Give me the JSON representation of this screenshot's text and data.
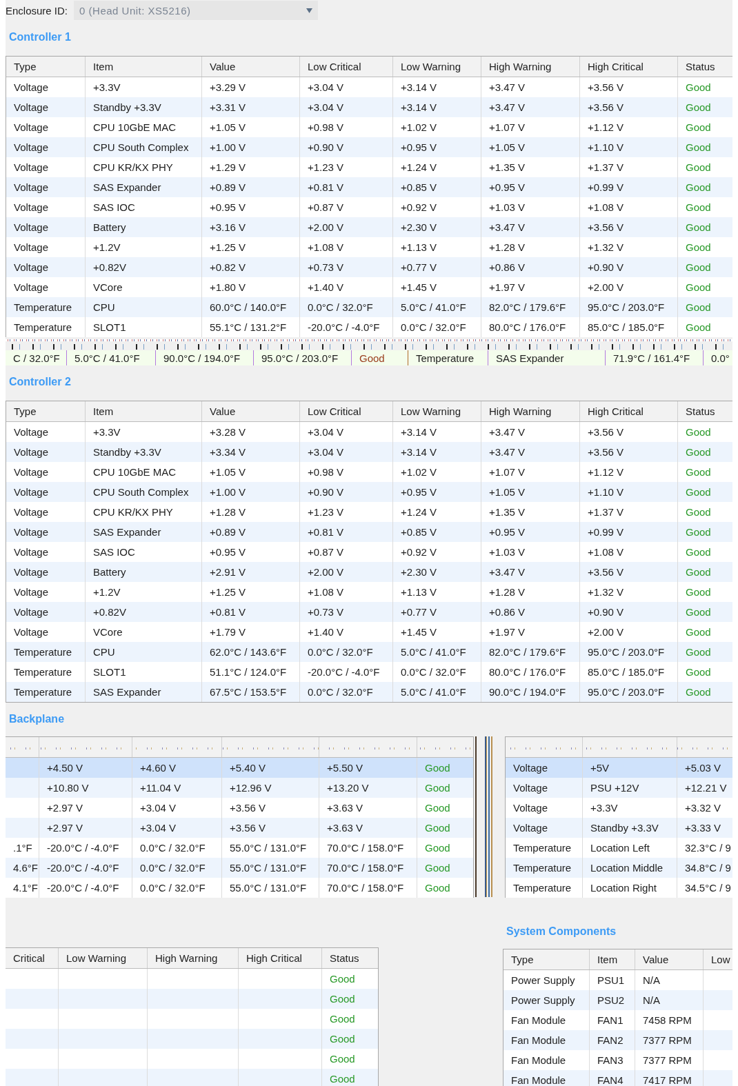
{
  "enclosure": {
    "label": "Enclosure ID:",
    "value": "0 (Head Unit: XS5216)"
  },
  "controller_1": {
    "title": "Controller 1",
    "columns": [
      "Type",
      "Item",
      "Value",
      "Low Critical",
      "Low Warning",
      "High Warning",
      "High Critical",
      "Status"
    ],
    "rows": [
      [
        "Voltage",
        "+3.3V",
        "+3.29 V",
        "+3.04 V",
        "+3.14 V",
        "+3.47 V",
        "+3.56 V",
        "Good"
      ],
      [
        "Voltage",
        "Standby +3.3V",
        "+3.31 V",
        "+3.04 V",
        "+3.14 V",
        "+3.47 V",
        "+3.56 V",
        "Good"
      ],
      [
        "Voltage",
        "CPU 10GbE MAC",
        "+1.05 V",
        "+0.98 V",
        "+1.02 V",
        "+1.07 V",
        "+1.12 V",
        "Good"
      ],
      [
        "Voltage",
        "CPU South Complex",
        "+1.00 V",
        "+0.90 V",
        "+0.95 V",
        "+1.05 V",
        "+1.10 V",
        "Good"
      ],
      [
        "Voltage",
        "CPU KR/KX PHY",
        "+1.29 V",
        "+1.23 V",
        "+1.24 V",
        "+1.35 V",
        "+1.37 V",
        "Good"
      ],
      [
        "Voltage",
        "SAS Expander",
        "+0.89 V",
        "+0.81 V",
        "+0.85 V",
        "+0.95 V",
        "+0.99 V",
        "Good"
      ],
      [
        "Voltage",
        "SAS IOC",
        "+0.95 V",
        "+0.87 V",
        "+0.92 V",
        "+1.03 V",
        "+1.08 V",
        "Good"
      ],
      [
        "Voltage",
        "Battery",
        "+3.16 V",
        "+2.00 V",
        "+2.30 V",
        "+3.47 V",
        "+3.56 V",
        "Good"
      ],
      [
        "Voltage",
        "+1.2V",
        "+1.25 V",
        "+1.08 V",
        "+1.13 V",
        "+1.28 V",
        "+1.32 V",
        "Good"
      ],
      [
        "Voltage",
        "+0.82V",
        "+0.82 V",
        "+0.73 V",
        "+0.77 V",
        "+0.86 V",
        "+0.90 V",
        "Good"
      ],
      [
        "Voltage",
        "VCore",
        "+1.80 V",
        "+1.40 V",
        "+1.45 V",
        "+1.97 V",
        "+2.00 V",
        "Good"
      ],
      [
        "Temperature",
        "CPU",
        "60.0°C / 140.0°F",
        "0.0°C / 32.0°F",
        "5.0°C / 41.0°F",
        "82.0°C / 179.6°F",
        "95.0°C / 203.0°F",
        "Good"
      ],
      [
        "Temperature",
        "SLOT1",
        "55.1°C / 131.2°F",
        "-20.0°C / -4.0°F",
        "0.0°C / 32.0°F",
        "80.0°C / 176.0°F",
        "85.0°C / 185.0°F",
        "Good"
      ]
    ]
  },
  "glitch_strip": [
    {
      "text": "C / 32.0°F",
      "kind": "value"
    },
    {
      "text": "5.0°C / 41.0°F",
      "kind": "value"
    },
    {
      "text": "90.0°C / 194.0°F",
      "kind": "value"
    },
    {
      "text": "95.0°C / 203.0°F",
      "kind": "value"
    },
    {
      "text": "Good",
      "kind": "status"
    },
    {
      "text": "Temperature",
      "kind": "value"
    },
    {
      "text": "SAS Expander",
      "kind": "value"
    },
    {
      "text": "71.9°C / 161.4°F",
      "kind": "value"
    },
    {
      "text": "0.0°",
      "kind": "value"
    }
  ],
  "controller_2": {
    "title": "Controller 2",
    "columns": [
      "Type",
      "Item",
      "Value",
      "Low Critical",
      "Low Warning",
      "High Warning",
      "High Critical",
      "Status"
    ],
    "rows": [
      [
        "Voltage",
        "+3.3V",
        "+3.28 V",
        "+3.04 V",
        "+3.14 V",
        "+3.47 V",
        "+3.56 V",
        "Good"
      ],
      [
        "Voltage",
        "Standby +3.3V",
        "+3.34 V",
        "+3.04 V",
        "+3.14 V",
        "+3.47 V",
        "+3.56 V",
        "Good"
      ],
      [
        "Voltage",
        "CPU 10GbE MAC",
        "+1.05 V",
        "+0.98 V",
        "+1.02 V",
        "+1.07 V",
        "+1.12 V",
        "Good"
      ],
      [
        "Voltage",
        "CPU South Complex",
        "+1.00 V",
        "+0.90 V",
        "+0.95 V",
        "+1.05 V",
        "+1.10 V",
        "Good"
      ],
      [
        "Voltage",
        "CPU KR/KX PHY",
        "+1.28 V",
        "+1.23 V",
        "+1.24 V",
        "+1.35 V",
        "+1.37 V",
        "Good"
      ],
      [
        "Voltage",
        "SAS Expander",
        "+0.89 V",
        "+0.81 V",
        "+0.85 V",
        "+0.95 V",
        "+0.99 V",
        "Good"
      ],
      [
        "Voltage",
        "SAS IOC",
        "+0.95 V",
        "+0.87 V",
        "+0.92 V",
        "+1.03 V",
        "+1.08 V",
        "Good"
      ],
      [
        "Voltage",
        "Battery",
        "+2.91 V",
        "+2.00 V",
        "+2.30 V",
        "+3.47 V",
        "+3.56 V",
        "Good"
      ],
      [
        "Voltage",
        "+1.2V",
        "+1.25 V",
        "+1.08 V",
        "+1.13 V",
        "+1.28 V",
        "+1.32 V",
        "Good"
      ],
      [
        "Voltage",
        "+0.82V",
        "+0.81 V",
        "+0.73 V",
        "+0.77 V",
        "+0.86 V",
        "+0.90 V",
        "Good"
      ],
      [
        "Voltage",
        "VCore",
        "+1.79 V",
        "+1.40 V",
        "+1.45 V",
        "+1.97 V",
        "+2.00 V",
        "Good"
      ],
      [
        "Temperature",
        "CPU",
        "62.0°C / 143.6°F",
        "0.0°C / 32.0°F",
        "5.0°C / 41.0°F",
        "82.0°C / 179.6°F",
        "95.0°C / 203.0°F",
        "Good"
      ],
      [
        "Temperature",
        "SLOT1",
        "51.1°C / 124.0°F",
        "-20.0°C / -4.0°F",
        "0.0°C / 32.0°F",
        "80.0°C / 176.0°F",
        "85.0°C / 185.0°F",
        "Good"
      ],
      [
        "Temperature",
        "SAS Expander",
        "67.5°C / 153.5°F",
        "0.0°C / 32.0°F",
        "5.0°C / 41.0°F",
        "90.0°C / 194.0°F",
        "95.0°C / 203.0°F",
        "Good"
      ]
    ]
  },
  "backplane": {
    "title": "Backplane",
    "left_table": {
      "rows": [
        {
          "cells": [
            "",
            "+4.50 V",
            "+4.60 V",
            "+5.40 V",
            "+5.50 V",
            "Good"
          ],
          "selected": true
        },
        {
          "cells": [
            "",
            "+10.80 V",
            "+11.04 V",
            "+12.96 V",
            "+13.20 V",
            "Good"
          ],
          "selected": false
        },
        {
          "cells": [
            "",
            "+2.97 V",
            "+3.04 V",
            "+3.56 V",
            "+3.63 V",
            "Good"
          ],
          "selected": false
        },
        {
          "cells": [
            "",
            "+2.97 V",
            "+3.04 V",
            "+3.56 V",
            "+3.63 V",
            "Good"
          ],
          "selected": false
        },
        {
          "cells": [
            ".1°F",
            "-20.0°C / -4.0°F",
            "0.0°C / 32.0°F",
            "55.0°C / 131.0°F",
            "70.0°C / 158.0°F",
            "Good"
          ],
          "selected": false
        },
        {
          "cells": [
            "4.6°F",
            "-20.0°C / -4.0°F",
            "0.0°C / 32.0°F",
            "55.0°C / 131.0°F",
            "70.0°C / 158.0°F",
            "Good"
          ],
          "selected": false
        },
        {
          "cells": [
            "4.1°F",
            "-20.0°C / -4.0°F",
            "0.0°C / 32.0°F",
            "55.0°C / 131.0°F",
            "70.0°C / 158.0°F",
            "Good"
          ],
          "selected": false
        }
      ]
    },
    "right_table": {
      "rows": [
        {
          "cells": [
            "Voltage",
            "+5V",
            "+5.03 V"
          ],
          "selected": true
        },
        {
          "cells": [
            "Voltage",
            "PSU +12V",
            "+12.21 V"
          ],
          "selected": false
        },
        {
          "cells": [
            "Voltage",
            "+3.3V",
            "+3.32 V"
          ],
          "selected": false
        },
        {
          "cells": [
            "Voltage",
            "Standby +3.3V",
            "+3.33 V"
          ],
          "selected": false
        },
        {
          "cells": [
            "Temperature",
            "Location Left",
            "32.3°C / 9"
          ],
          "selected": false
        },
        {
          "cells": [
            "Temperature",
            "Location Middle",
            "34.8°C / 9"
          ],
          "selected": false
        },
        {
          "cells": [
            "Temperature",
            "Location Right",
            "34.5°C / 9"
          ],
          "selected": false
        }
      ]
    }
  },
  "lower_table": {
    "columns": [
      "Critical",
      "Low Warning",
      "High Warning",
      "High Critical",
      "Status"
    ],
    "rows": [
      [
        "",
        "",
        "",
        "",
        "Good"
      ],
      [
        "",
        "",
        "",
        "",
        "Good"
      ],
      [
        "",
        "",
        "",
        "",
        "Good"
      ],
      [
        "",
        "",
        "",
        "",
        "Good"
      ],
      [
        "",
        "",
        "",
        "",
        "Good"
      ],
      [
        "",
        "",
        "",
        "",
        "Good"
      ]
    ]
  },
  "system_components": {
    "title": "System Components",
    "columns": [
      "Type",
      "Item",
      "Value",
      "Low"
    ],
    "rows": [
      [
        "Power Supply",
        "PSU1",
        "N/A",
        ""
      ],
      [
        "Power Supply",
        "PSU2",
        "N/A",
        ""
      ],
      [
        "Fan Module",
        "FAN1",
        "7458 RPM",
        ""
      ],
      [
        "Fan Module",
        "FAN2",
        "7377 RPM",
        ""
      ],
      [
        "Fan Module",
        "FAN3",
        "7377 RPM",
        ""
      ],
      [
        "Fan Module",
        "FAN4",
        "7417 RPM",
        ""
      ]
    ]
  }
}
